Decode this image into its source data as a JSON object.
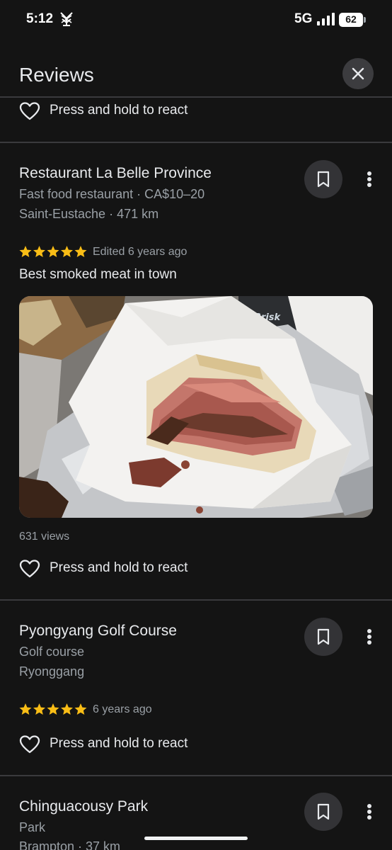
{
  "status_bar": {
    "time": "5:12",
    "network": "5G",
    "battery": "62"
  },
  "header": {
    "title": "Reviews",
    "close_icon": "close-icon"
  },
  "react_label": "Press and hold to react",
  "reviews": [
    {
      "place_name": "Restaurant La Belle Province",
      "category": "Fast food restaurant · CA$10–20",
      "location": "Saint-Eustache · 471 km",
      "rating": 5,
      "time": "Edited 6 years ago",
      "text": "Best smoked meat in town",
      "photo": "smoked-meat-sandwich",
      "views": "631 views"
    },
    {
      "place_name": "Pyongyang Golf Course",
      "category": "Golf course",
      "location": "Ryonggang",
      "rating": 5,
      "time": "6 years ago"
    },
    {
      "place_name": "Chinguacousy Park",
      "category": "Park",
      "location": "Brampton · 37 km"
    }
  ],
  "colors": {
    "background": "#141414",
    "star": "#f9bd16",
    "secondary_text": "#9aa0a6",
    "divider": "#3a3a3d"
  }
}
